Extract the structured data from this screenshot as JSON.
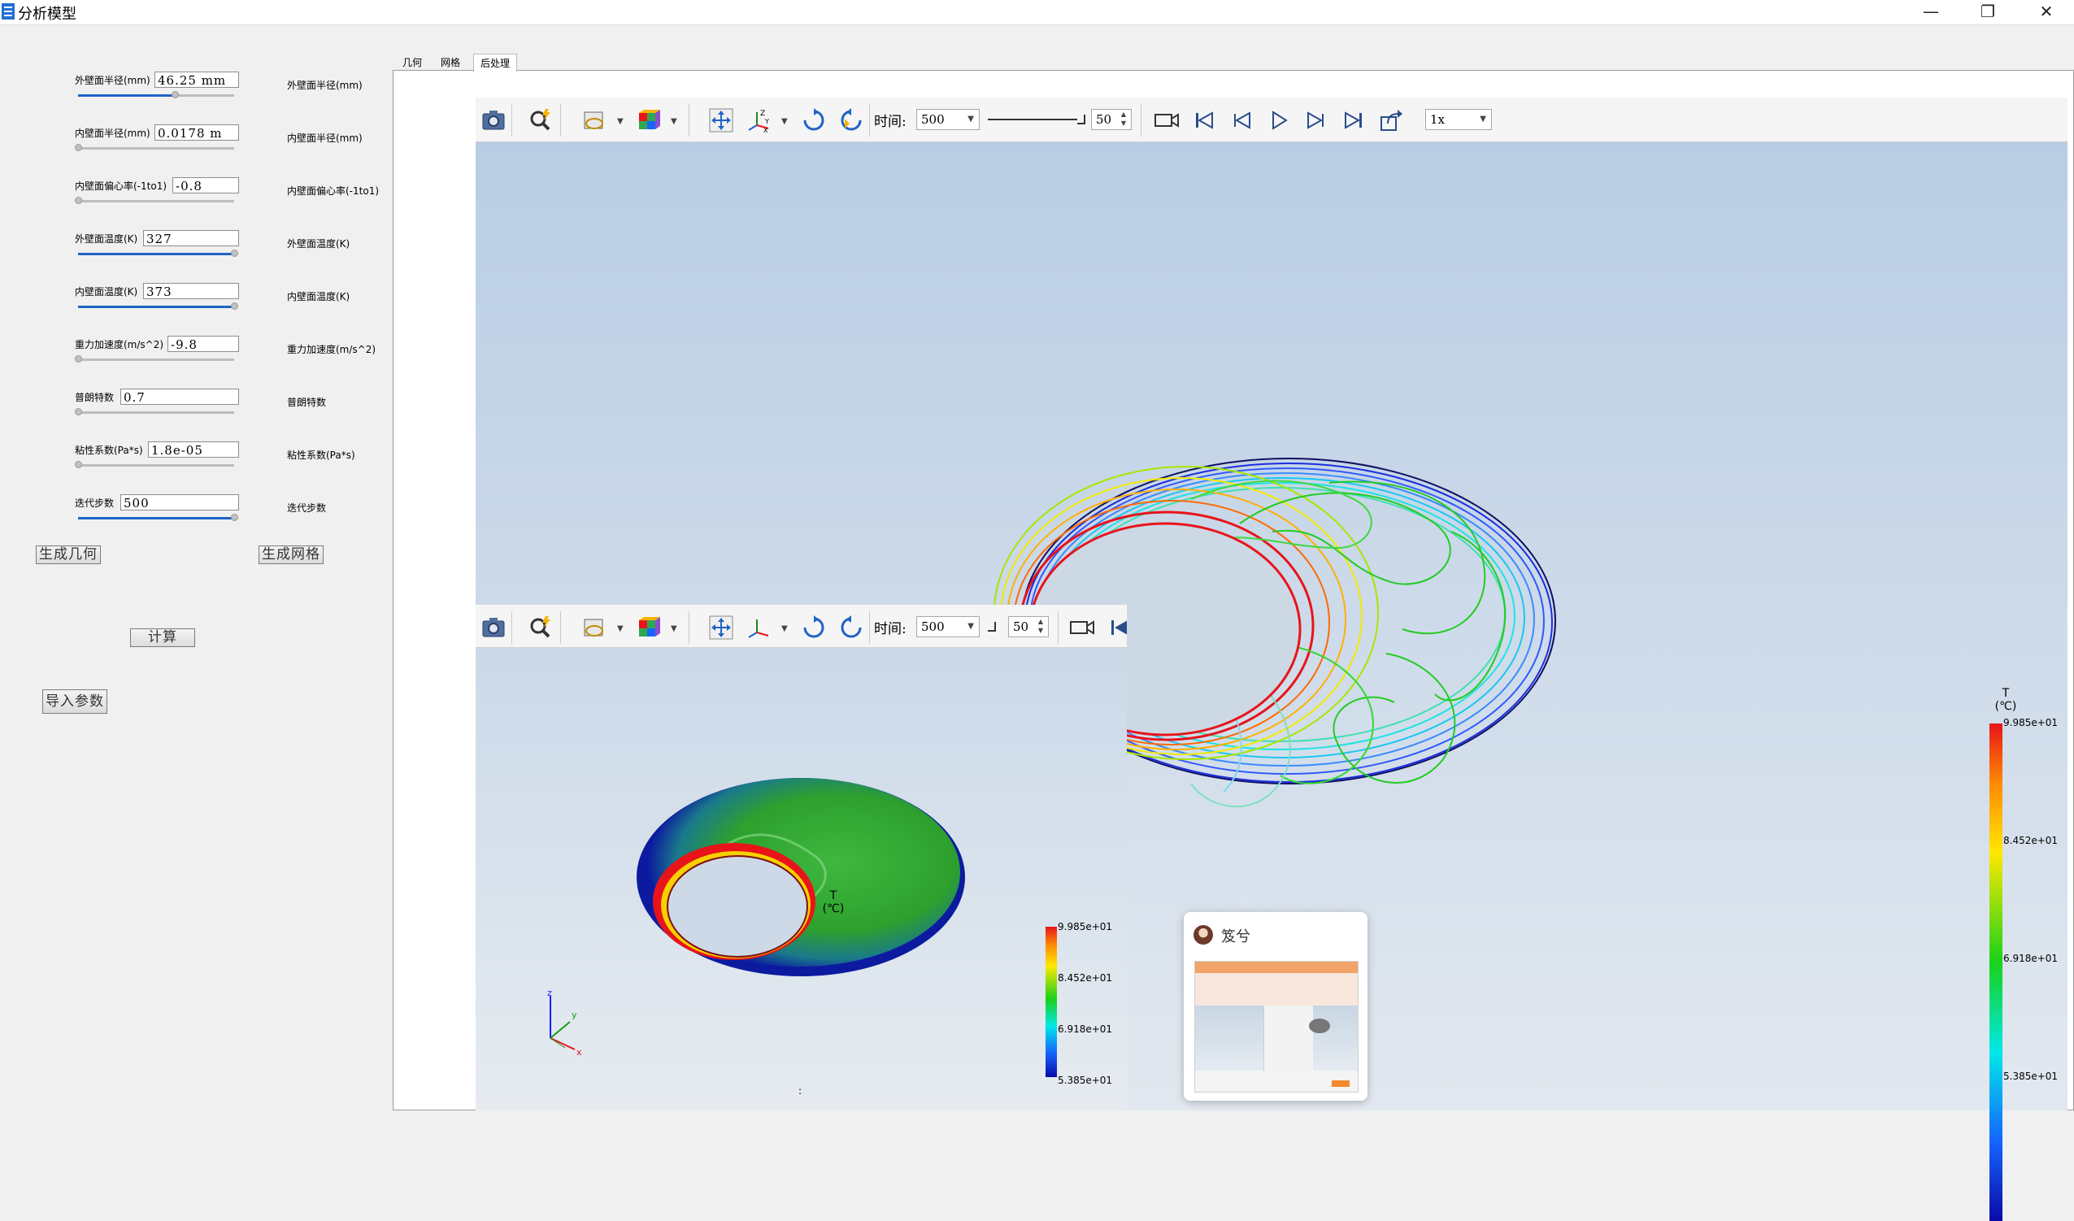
{
  "window": {
    "title": "分析模型",
    "controls": {
      "minimize": "—",
      "maximize": "❐",
      "close": "✕"
    }
  },
  "params": [
    {
      "label": "外壁面半径(mm)",
      "value": "46.25 mm",
      "slider": 0.62,
      "right_label": "外壁面半径(mm)"
    },
    {
      "label": "内壁面半径(mm)",
      "value": "0.0178 m",
      "slider": 0.0,
      "right_label": "内壁面半径(mm)"
    },
    {
      "label": "内壁面偏心率(-1to1)",
      "value": "-0.8",
      "slider": 0.0,
      "right_label": "内壁面偏心率(-1to1)"
    },
    {
      "label": "外壁面温度(K)",
      "value": "327",
      "slider": 1.0,
      "right_label": "外壁面温度(K)"
    },
    {
      "label": "内壁面温度(K)",
      "value": "373",
      "slider": 1.0,
      "right_label": "内壁面温度(K)"
    },
    {
      "label": "重力加速度(m/s^2)",
      "value": "-9.8",
      "slider": 0.0,
      "right_label": "重力加速度(m/s^2)"
    },
    {
      "label": "普朗特数",
      "value": "0.7",
      "slider": 0.0,
      "right_label": "普朗特数"
    },
    {
      "label": "粘性系数(Pa*s)",
      "value": "1.8e-05",
      "slider": 0.0,
      "right_label": "粘性系数(Pa*s)"
    },
    {
      "label": "迭代步数",
      "value": "500",
      "slider": 1.0,
      "right_label": "迭代步数"
    }
  ],
  "buttons": {
    "gen_geometry": "生成几何",
    "gen_mesh": "生成网格",
    "compute": "计算",
    "import_params": "导入参数"
  },
  "tabs": [
    {
      "label": "几何"
    },
    {
      "label": "网格"
    },
    {
      "label": "后处理",
      "active": true
    }
  ],
  "toolbar": {
    "time_label": "时间:",
    "time_value": "500",
    "step_value": "50",
    "speed_value": "1x"
  },
  "legend": {
    "title_top": "T",
    "title_unit": "(℃)",
    "labels": [
      "9.985e+01",
      "8.452e+01",
      "6.918e+01",
      "5.385e+01"
    ],
    "colors": [
      "#e8141a",
      "#ff8a00",
      "#ffe800",
      "#19d219",
      "#00e8e8",
      "#1565ff",
      "#0a0aa8"
    ]
  },
  "axes": {
    "z": "z",
    "y": "y",
    "x": "x"
  },
  "notification": {
    "title": "笈兮"
  },
  "status_text": ":"
}
